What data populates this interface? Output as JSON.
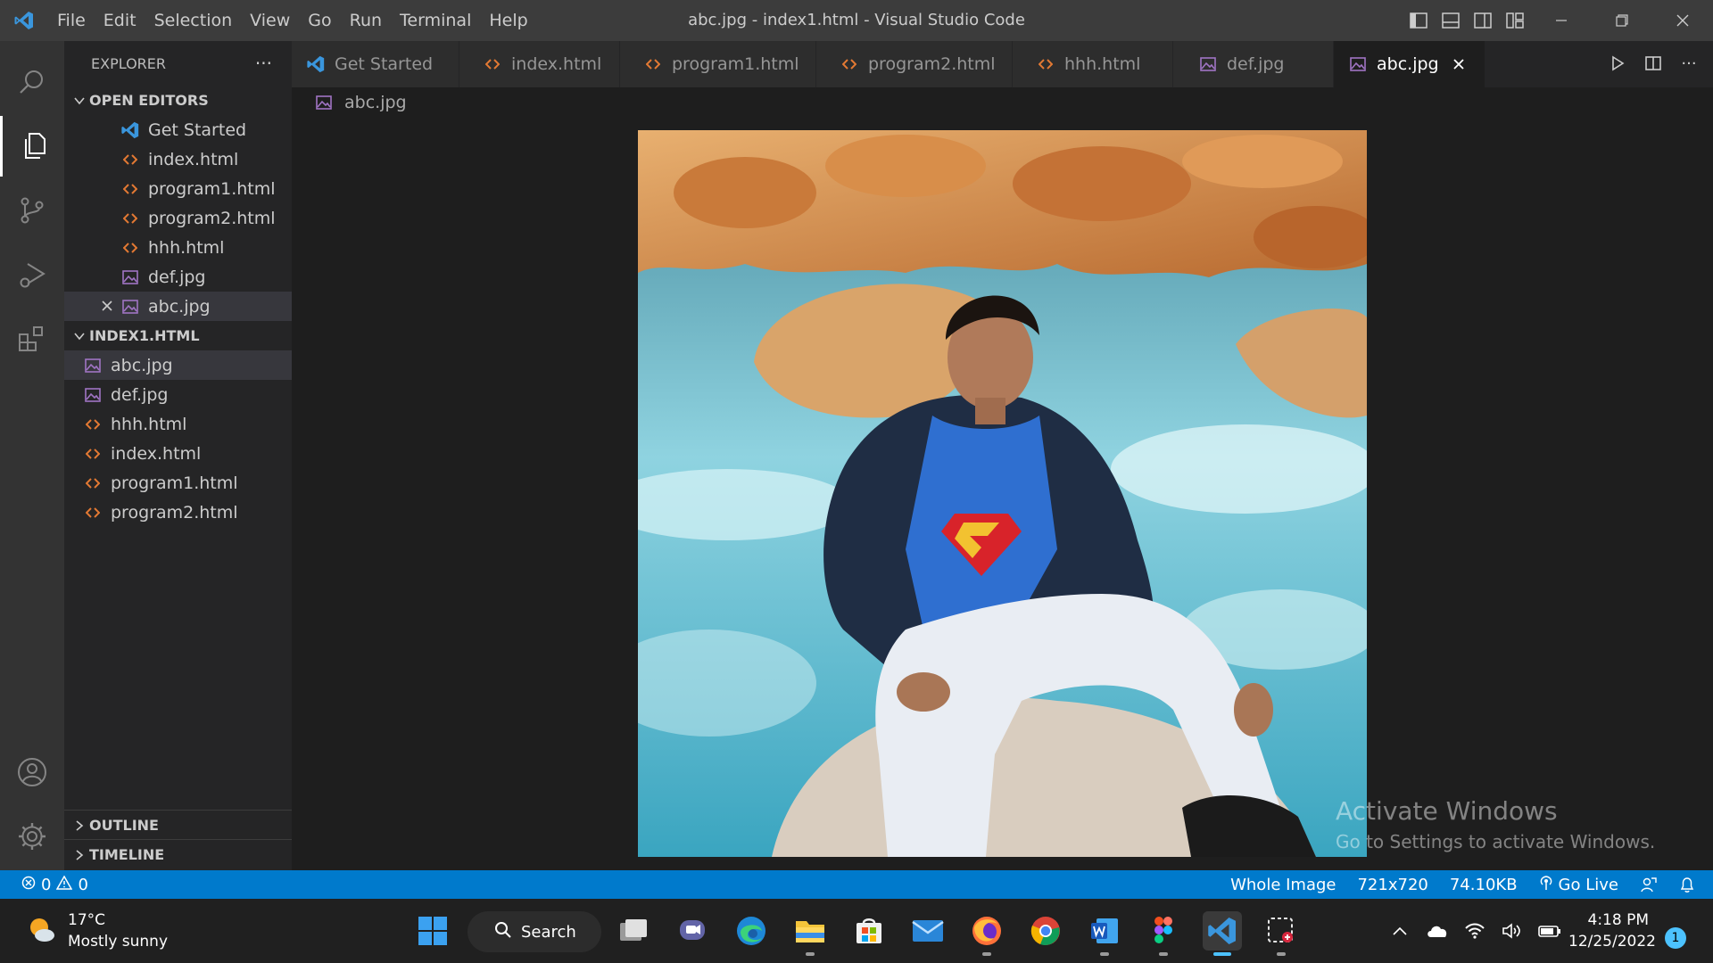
{
  "window": {
    "title": "abc.jpg - index1.html - Visual Studio Code"
  },
  "menu": [
    "File",
    "Edit",
    "Selection",
    "View",
    "Go",
    "Run",
    "Terminal",
    "Help"
  ],
  "sidebar": {
    "header": "EXPLORER",
    "open_editors_label": "OPEN EDITORS",
    "open_editors": [
      {
        "label": "Get Started",
        "icon": "vscode-icon"
      },
      {
        "label": "index.html",
        "icon": "html-icon"
      },
      {
        "label": "program1.html",
        "icon": "html-icon"
      },
      {
        "label": "program2.html",
        "icon": "html-icon"
      },
      {
        "label": "hhh.html",
        "icon": "html-icon"
      },
      {
        "label": "def.jpg",
        "icon": "image-icon"
      },
      {
        "label": "abc.jpg",
        "icon": "image-icon",
        "active": true
      }
    ],
    "workspace_label": "INDEX1.HTML",
    "workspace_files": [
      {
        "label": "abc.jpg",
        "icon": "image-icon",
        "selected": true
      },
      {
        "label": "def.jpg",
        "icon": "image-icon"
      },
      {
        "label": "hhh.html",
        "icon": "html-icon"
      },
      {
        "label": "index.html",
        "icon": "html-icon"
      },
      {
        "label": "program1.html",
        "icon": "html-icon"
      },
      {
        "label": "program2.html",
        "icon": "html-icon"
      }
    ],
    "outline_label": "OUTLINE",
    "timeline_label": "TIMELINE"
  },
  "tabs": [
    {
      "label": "Get Started",
      "icon": "vscode-icon"
    },
    {
      "label": "index.html",
      "icon": "html-icon"
    },
    {
      "label": "program1.html",
      "icon": "html-icon"
    },
    {
      "label": "program2.html",
      "icon": "html-icon"
    },
    {
      "label": "hhh.html",
      "icon": "html-icon"
    },
    {
      "label": "def.jpg",
      "icon": "image-icon"
    },
    {
      "label": "abc.jpg",
      "icon": "image-icon",
      "active": true
    }
  ],
  "breadcrumb": "abc.jpg",
  "watermark": {
    "line1": "Activate Windows",
    "line2": "Go to Settings to activate Windows."
  },
  "statusbar": {
    "errors": "0",
    "warnings": "0",
    "zoom": "Whole Image",
    "dimensions": "721x720",
    "size": "74.10KB",
    "golive": "Go Live"
  },
  "taskbar": {
    "temperature": "17°C",
    "weather": "Mostly sunny",
    "search": "Search",
    "time": "4:18 PM",
    "date": "12/25/2022",
    "notifications": "1"
  },
  "colors": {
    "accent": "#007acc",
    "html_icon": "#e37933",
    "image_icon": "#a074c4",
    "vscode_blue": "#3a96dd"
  }
}
